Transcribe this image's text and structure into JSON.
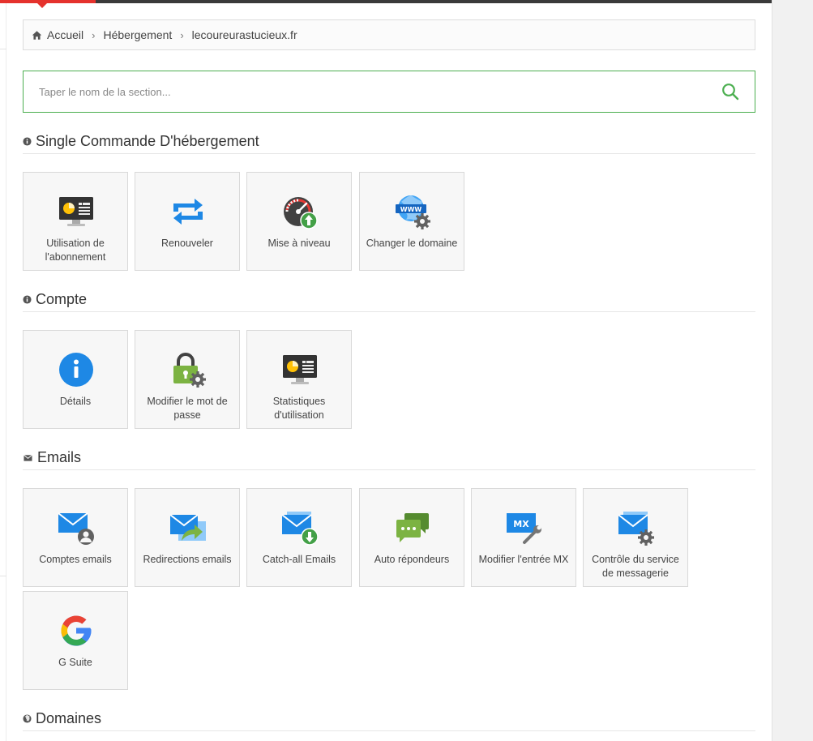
{
  "breadcrumb": {
    "items": [
      "Accueil",
      "Hébergement",
      "lecoureurastucieux.fr"
    ]
  },
  "search": {
    "placeholder": "Taper le nom de la section..."
  },
  "sections": {
    "hosting": {
      "title": "Single Commande D'hébergement",
      "tiles": [
        "Utilisation de l'abonnement",
        "Renouveler",
        "Mise à niveau",
        "Changer le domaine"
      ]
    },
    "account": {
      "title": "Compte",
      "tiles": [
        "Détails",
        "Modifier le mot de passe",
        "Statistiques d'utilisation"
      ]
    },
    "emails": {
      "title": "Emails",
      "tiles": [
        "Comptes emails",
        "Redirections emails",
        "Catch-all Emails",
        "Auto répondeurs",
        "Modifier l'entrée MX",
        "Contrôle du service de messagerie",
        "G Suite"
      ]
    },
    "domains": {
      "title": "Domaines"
    }
  },
  "icons": {
    "home": "home-icon",
    "search": "search-icon",
    "info": "info-circle-icon",
    "envelope": "envelope-icon",
    "globe": "globe-icon"
  },
  "colors": {
    "accent": "#e5322d",
    "search_border": "#4caf50",
    "blue": "#1e88e5",
    "green": "#4caf50"
  }
}
